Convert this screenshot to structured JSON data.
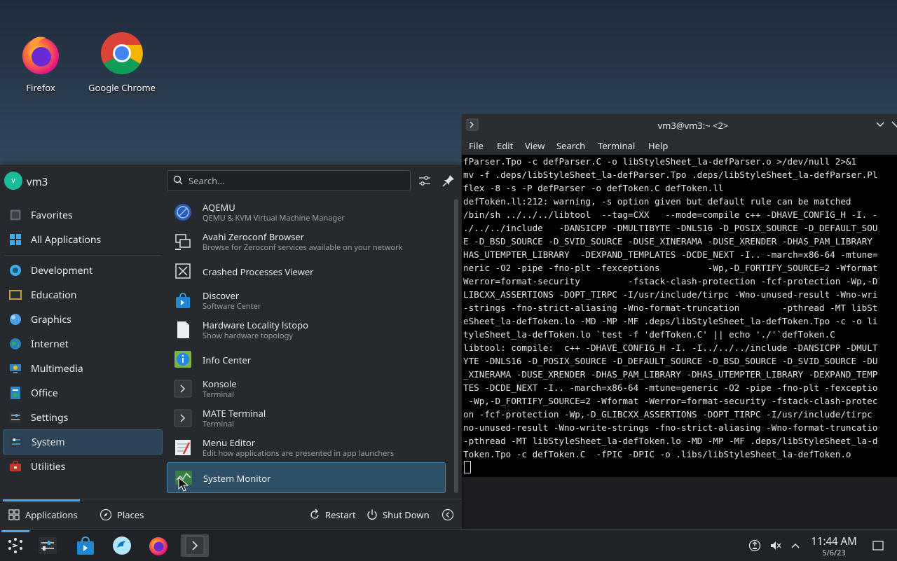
{
  "desktop": {
    "icons": [
      {
        "label": "Firefox",
        "icon": "firefox-icon"
      },
      {
        "label": "Google Chrome",
        "icon": "chrome-icon"
      }
    ]
  },
  "launcher": {
    "user": {
      "name": "vm3",
      "initial": "v"
    },
    "search": {
      "placeholder": "Search..."
    },
    "categories": [
      {
        "label": "Favorites",
        "icon": "favorites-icon"
      },
      {
        "label": "All Applications",
        "icon": "all-applications-icon"
      },
      {
        "label": "Development",
        "icon": "development-icon"
      },
      {
        "label": "Education",
        "icon": "education-icon"
      },
      {
        "label": "Graphics",
        "icon": "graphics-icon"
      },
      {
        "label": "Internet",
        "icon": "internet-icon"
      },
      {
        "label": "Multimedia",
        "icon": "multimedia-icon"
      },
      {
        "label": "Office",
        "icon": "office-icon"
      },
      {
        "label": "Settings",
        "icon": "settings-icon"
      },
      {
        "label": "System",
        "icon": "system-icon",
        "active": true
      },
      {
        "label": "Utilities",
        "icon": "utilities-icon"
      }
    ],
    "apps": [
      {
        "name": "AQEMU",
        "desc": "QEMU & KVM Virtual Machine Manager",
        "icon": "aqemu-icon"
      },
      {
        "name": "Avahi Zeroconf Browser",
        "desc": "Browse for Zeroconf services available on your network",
        "icon": "avahi-icon"
      },
      {
        "name": "Crashed Processes Viewer",
        "desc": "",
        "icon": "crash-viewer-icon"
      },
      {
        "name": "Discover",
        "desc": "Software Center",
        "icon": "discover-icon"
      },
      {
        "name": "Hardware Locality lstopo",
        "desc": "Show hardware topology",
        "icon": "lstopo-icon"
      },
      {
        "name": "Info Center",
        "desc": "",
        "icon": "info-center-icon"
      },
      {
        "name": "Konsole",
        "desc": "Terminal",
        "icon": "konsole-icon"
      },
      {
        "name": "MATE Terminal",
        "desc": "Terminal",
        "icon": "mate-terminal-icon"
      },
      {
        "name": "Menu Editor",
        "desc": "Edit how applications are presented in app launchers",
        "icon": "menu-editor-icon"
      },
      {
        "name": "System Monitor",
        "desc": "",
        "icon": "system-monitor-icon",
        "selected": true
      }
    ],
    "footer": {
      "applications_label": "Applications",
      "places_label": "Places",
      "restart_label": "Restart",
      "shutdown_label": "Shut Down"
    }
  },
  "terminal": {
    "title": "vm3@vm3:~ <2>",
    "menu": [
      "File",
      "Edit",
      "View",
      "Search",
      "Terminal",
      "Help"
    ],
    "lines": [
      "fParser.Tpo -c defParser.C -o libStyleSheet_la-defParser.o >/dev/null 2>&1",
      "mv -f .deps/libStyleSheet_la-defParser.Tpo .deps/libStyleSheet_la-defParser.Pl",
      "flex -8 -s -P defParser -o defToken.C defToken.ll",
      "defToken.ll:212: warning, -s option given but default rule can be matched",
      "/bin/sh ../../../libtool  --tag=CXX   --mode=compile c++ -DHAVE_CONFIG_H -I. -",
      "./../../include   -DANSICPP -DMULTIBYTE -DNLS16 -D_POSIX_SOURCE -D_DEFAULT_SOU",
      "E -D_BSD_SOURCE -D_SVID_SOURCE -DUSE_XINERAMA -DUSE_XRENDER -DHAS_PAM_LIBRARY",
      "HAS_UTEMPTER_LIBRARY  -DEXPAND_TEMPLATES -DCDE_NEXT -I.. -march=x86-64 -mtune=",
      "neric -O2 -pipe -fno-plt -fexceptions         -Wp,-D_FORTIFY_SOURCE=2 -Wformat",
      "Werror=format-security         -fstack-clash-protection -fcf-protection -Wp,-D",
      "LIBCXX_ASSERTIONS -DOPT_TIRPC -I/usr/include/tirpc -Wno-unused-result -Wno-wri",
      "-strings -fno-strict-aliasing -Wno-format-truncation        -pthread -MT libSt",
      "eSheet_la-defToken.lo -MD -MP -MF .deps/libStyleSheet_la-defToken.Tpo -c -o li",
      "tyleSheet_la-defToken.lo `test -f 'defToken.C' || echo './'`defToken.C",
      "libtool: compile:  c++ -DHAVE_CONFIG_H -I. -I../../../include -DANSICPP -DMULT",
      "YTE -DNLS16 -D_POSIX_SOURCE -D_DEFAULT_SOURCE -D_BSD_SOURCE -D_SVID_SOURCE -DU",
      "_XINERAMA -DUSE_XRENDER -DHAS_PAM_LIBRARY -DHAS_UTEMPTER_LIBRARY -DEXPAND_TEMP",
      "TES -DCDE_NEXT -I.. -march=x86-64 -mtune=generic -O2 -pipe -fno-plt -fexceptio",
      " -Wp,-D_FORTIFY_SOURCE=2 -Wformat -Werror=format-security -fstack-clash-protec",
      "on -fcf-protection -Wp,-D_GLIBCXX_ASSERTIONS -DOPT_TIRPC -I/usr/include/tirpc",
      "no-unused-result -Wno-write-strings -fno-strict-aliasing -Wno-format-truncatio",
      "-pthread -MT libStyleSheet_la-defToken.lo -MD -MP -MF .deps/libStyleSheet_la-d",
      "Token.Tpo -c defToken.C  -fPIC -DPIC -o .libs/libStyleSheet_la-defToken.o"
    ]
  },
  "taskbar": {
    "clock_time": "11:44 AM",
    "clock_date": "5/6/23",
    "items": [
      "app-launcher-icon",
      "settings-icon",
      "discover-icon",
      "dolphin-icon",
      "firefox-icon",
      "konsole-icon"
    ]
  },
  "colors": {
    "accent": "#3daee9",
    "panel_bg": "#26292e",
    "selected_bg": "#2d5067"
  }
}
